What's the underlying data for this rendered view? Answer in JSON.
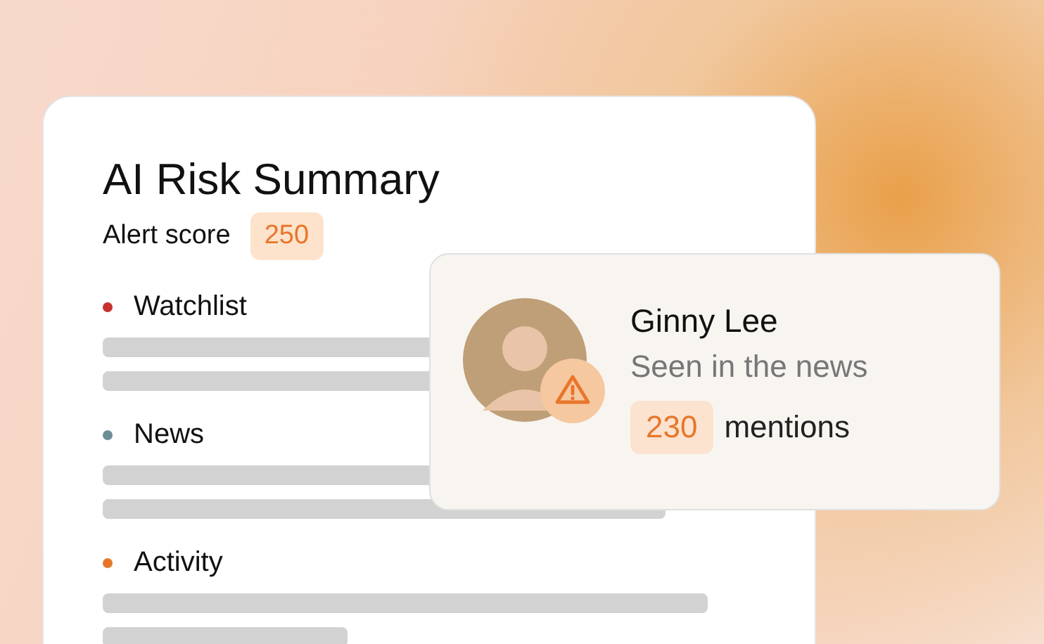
{
  "summary": {
    "title": "AI Risk Summary",
    "score_label": "Alert score",
    "score": "250",
    "sections": [
      {
        "name": "Watchlist",
        "color": "#c8312f"
      },
      {
        "name": "News",
        "color": "#6b8e97"
      },
      {
        "name": "Activity",
        "color": "#e8762a"
      }
    ]
  },
  "profile": {
    "name": "Ginny Lee",
    "subtitle": "Seen in the news",
    "count": "230",
    "count_label": "mentions"
  }
}
